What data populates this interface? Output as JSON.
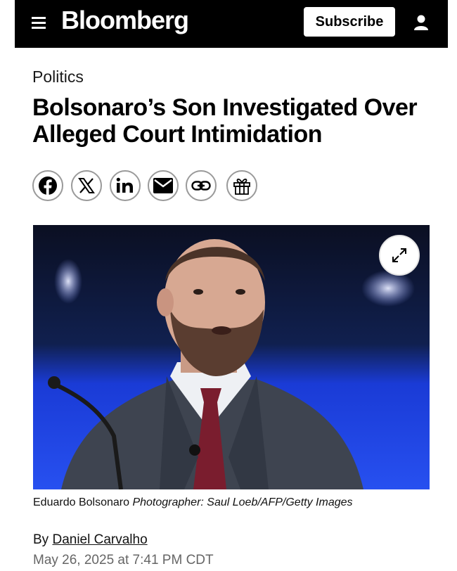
{
  "header": {
    "brand": "Bloomberg",
    "subscribe_label": "Subscribe",
    "menu_icon": "hamburger-menu-icon",
    "account_icon": "user-account-icon",
    "background_color": "#000000"
  },
  "article": {
    "section": "Politics",
    "headline": "Bolsonaro’s Son Investigated Over Alleged Court Intimidation",
    "share_buttons": [
      "facebook-icon",
      "x-icon",
      "linkedin-icon",
      "email-icon",
      "link-icon",
      "gift-icon"
    ],
    "image": {
      "expand_icon": "expand-arrows-icon"
    },
    "caption": {
      "subject": "Eduardo Bolsonaro",
      "credit": "Photographer: Saul Loeb/AFP/Getty Images"
    },
    "byline": {
      "prefix": "By",
      "author": "Daniel Carvalho"
    },
    "dateline": "May 26, 2025 at 7:41 PM CDT"
  }
}
